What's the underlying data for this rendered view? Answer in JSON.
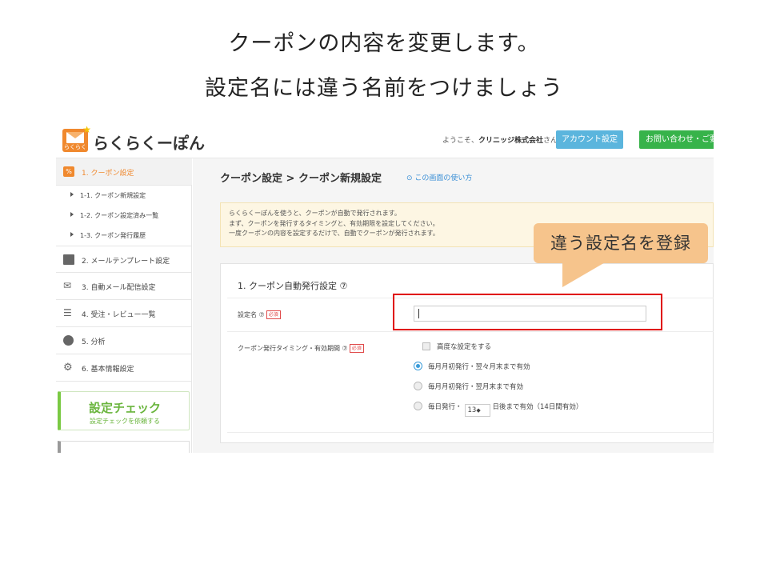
{
  "slide": {
    "title_line1": "クーポンの内容を変更します。",
    "title_line2": "設定名には違う名前をつけましょう"
  },
  "header": {
    "logo_text": "らくらくーぽん",
    "logo_icon_caption": "らくらく",
    "welcome": "ようこそ、",
    "company": "クリニッジ株式会社",
    "san": "さん",
    "account_button": "アカウント設定",
    "contact_button": "お問い合わせ・ご要望"
  },
  "sidebar": {
    "items": [
      {
        "label": "1. クーポン設定",
        "icon": "percent-icon",
        "active": true
      },
      {
        "label": "2. メールテンプレート設定",
        "icon": "mail-icon"
      },
      {
        "label": "3. 自動メール配信設定",
        "icon": "mail-settings-icon"
      },
      {
        "label": "4. 受注・レビュー一覧",
        "icon": "list-icon"
      },
      {
        "label": "5. 分析",
        "icon": "pie-chart-icon"
      },
      {
        "label": "6. 基本情報設定",
        "icon": "cog-icon"
      }
    ],
    "sub_items": [
      "1-1. クーポン新規設定",
      "1-2. クーポン設定済み一覧",
      "1-3. クーポン発行履歴"
    ],
    "check_title": "設定チェック",
    "check_sub": "設定チェックを依頼する"
  },
  "main": {
    "heading": "クーポン設定 > クーポン新規設定",
    "help_link": "⊙ この画面の使い方",
    "notice": [
      "らくらくーぽんを使うと、クーポンが自動で発行されます。",
      "まず、クーポンを発行するタイミングと、有効期限を設定してください。",
      "一度クーポンの内容を設定するだけで、自動でクーポンが発行されます。"
    ],
    "section_title": "1. クーポン自動発行設定 ⑦",
    "name_label": "設定名 ⑦",
    "required": "必須",
    "name_value": "",
    "timing_label": "クーポン発行タイミング・有効期間 ⑦",
    "advanced_checkbox": "高度な設定をする",
    "options": [
      {
        "label": "毎月月初発行・翌々月末まで有効",
        "selected": true
      },
      {
        "label": "毎月月初発行・翌月末まで有効",
        "selected": false
      }
    ],
    "daily_prefix": "毎日発行・",
    "daily_value": "13",
    "daily_suffix": "日後まで有効（14日間有効）"
  },
  "annotation": {
    "callout": "違う設定名を登録",
    "frame_color": "#e00000",
    "callout_color": "#f6c48c"
  },
  "colors": {
    "accent_orange": "#f0892e",
    "account_blue": "#5bb5dd",
    "contact_green": "#37b34a",
    "check_green": "#6ab53d",
    "link_blue": "#3a8fd6"
  }
}
